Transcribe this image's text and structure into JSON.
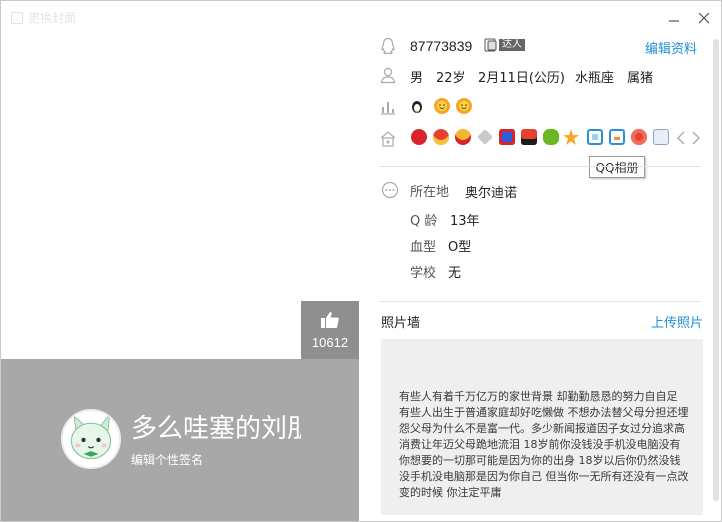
{
  "window": {
    "cover_title": "更换封面",
    "like_count": "10612",
    "nickname": "多么哇塞的刘朋",
    "signature_placeholder": "编辑个性签名"
  },
  "profile": {
    "qq_number": "87773839",
    "talent_badge": "达人",
    "edit_label": "编辑资料",
    "gender": "男",
    "age": "22岁",
    "birthday": "2月11日(公历)",
    "zodiac": "水瓶座",
    "chinese_zodiac": "属猪"
  },
  "details": {
    "location_label": "所在地",
    "location_value": "奥尔迪诺",
    "qage_label": "Q 龄",
    "qage_value": "13年",
    "blood_label": "血型",
    "blood_value": "O型",
    "school_label": "学校",
    "school_value": "无"
  },
  "tooltip": "QQ相册",
  "photo_wall": {
    "title": "照片墙",
    "upload_label": "上传照片",
    "text": "有些人有着千万亿万的家世背景 却勤勤恳恳的努力自自足 有些人出生于普通家庭却好吃懒做 不想办法替父母分担还埋怨父母为什么不是富一代。多少新闻报道因子女过分追求高消费让年迈父母跪地流泪 18岁前你没钱没手机没电脑没有你想要的一切那可能是因为你的出身 18岁以后你仍然没钱没手机没电脑那是因为你自己 但当你一无所有还没有一点改变的时候 你注定平庸"
  },
  "icons": {
    "cover": "image-tile-icon",
    "like": "thumbs-up-icon",
    "qq": "qq-penguin-icon",
    "user": "user-icon",
    "level": "level-bars-icon",
    "service": "house-icon",
    "more": "ellipsis-circle-icon"
  },
  "colors": {
    "accent_blue": "#1e8fd6",
    "cover_gray": "#a8a8a8",
    "like_gray": "#8f8f8f"
  }
}
